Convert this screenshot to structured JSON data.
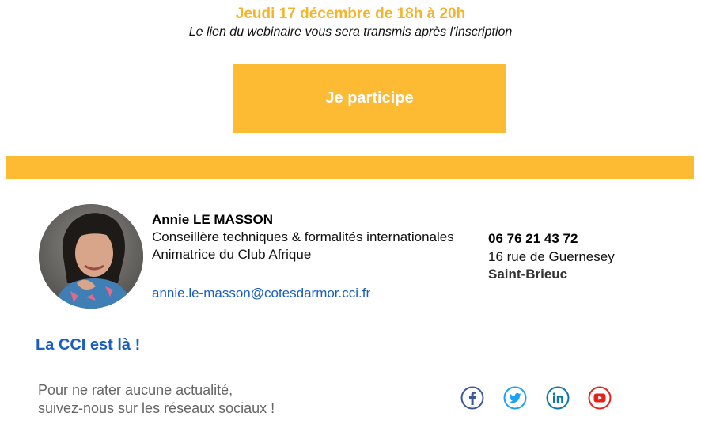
{
  "event": {
    "date_line": "Jeudi 17 décembre de 18h à 20h",
    "note": "Le lien du webinaire vous sera transmis après l'inscription",
    "cta_label": "Je participe"
  },
  "contact": {
    "name": "Annie LE MASSON",
    "role_line_1": "Conseillère techniques & formalités internationales",
    "role_line_2": "Animatrice du Club Afrique",
    "email": "annie.le-masson@cotesdarmor.cci.fr",
    "phone": "06 76 21 43 72",
    "street": "16 rue de Guernesey",
    "city": "Saint-Brieuc"
  },
  "footer": {
    "heading": "La CCI est là !",
    "follow_line_1": "Pour ne rater aucune actualité,",
    "follow_line_2": "suivez-nous sur les réseaux sociaux !"
  },
  "social_icons": [
    "facebook-icon",
    "twitter-icon",
    "linkedin-icon",
    "youtube-icon"
  ],
  "colors": {
    "accent_yellow": "#FDBA33",
    "date_yellow": "#F5B52A",
    "link_blue": "#1a5ec0",
    "facebook": "#3b5998",
    "twitter": "#1da1f2",
    "linkedin": "#0e76a8",
    "youtube": "#e62117"
  }
}
